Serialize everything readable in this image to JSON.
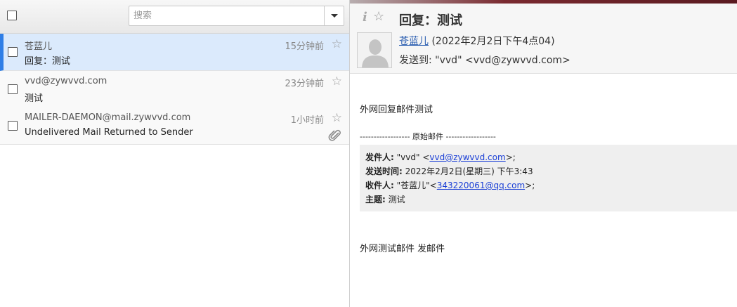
{
  "list": {
    "search_placeholder": "搜索",
    "messages": [
      {
        "from": "苍蓝儿",
        "subject": "回复：测试",
        "time": "15分钟前",
        "selected": true,
        "attachment": false
      },
      {
        "from": "vvd@zywvvd.com",
        "subject": "测试",
        "time": "23分钟前",
        "selected": false,
        "attachment": false
      },
      {
        "from": "MAILER-DAEMON@mail.zywvvd.com",
        "subject": "Undelivered Mail Returned to Sender",
        "time": "1小时前",
        "selected": false,
        "attachment": true
      }
    ]
  },
  "mail": {
    "subject": "回复：测试",
    "sender_name": "苍蓝儿",
    "sender_date": "(2022年2月2日下午4点04)",
    "sendto_label": "发送到:",
    "sendto_value": "\"vvd\" <vvd@zywvvd.com>",
    "body_first": "外网回复邮件测试",
    "original_separator": "------------------ 原始邮件 ------------------",
    "quote": {
      "from_label": "发件人:",
      "from_prefix": "\"vvd\" <",
      "from_email": "vvd@zywvvd.com",
      "from_suffix": ">;",
      "sent_label": "发送时间:",
      "sent_value": "2022年2月2日(星期三) 下午3:43",
      "to_label": "收件人:",
      "to_prefix": "\"苍蓝儿\"<",
      "to_email": "343220061@qq.com",
      "to_suffix": ">;",
      "subject_label": "主题:",
      "subject_value": "测试"
    },
    "body_last": "外网测试邮件 发邮件"
  },
  "colors": {
    "selected_bg": "#dbeafc",
    "selected_accent": "#2f7ee6",
    "link": "#1a3fd6"
  },
  "icons": {
    "star": "star-icon",
    "attachment": "paperclip-icon",
    "info": "info-icon",
    "avatar": "avatar-placeholder",
    "dropdown": "chevron-down-icon"
  }
}
